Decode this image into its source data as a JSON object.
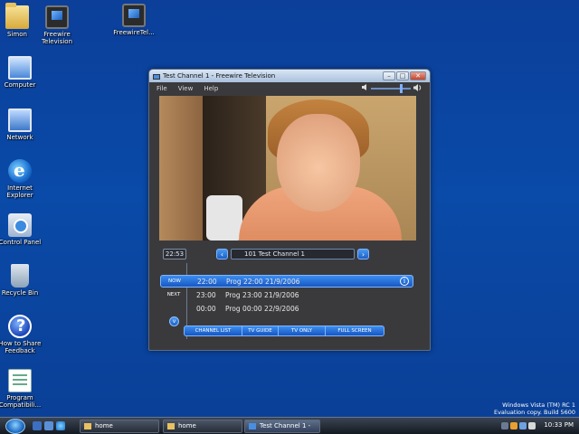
{
  "desktop": {
    "icons": [
      {
        "label": "Simon"
      },
      {
        "label": "Freewire Television"
      },
      {
        "label": "FreewireTel..."
      },
      {
        "label": "Computer"
      },
      {
        "label": "Network"
      },
      {
        "label": "Internet Explorer"
      },
      {
        "label": "Control Panel"
      },
      {
        "label": "Recycle Bin"
      },
      {
        "label": "How to Share Feedback"
      },
      {
        "label": "Program Compatibili..."
      }
    ]
  },
  "window": {
    "title": "Test Channel 1 - Freewire Television",
    "controls": {
      "minimize": "–",
      "maximize": "□",
      "close": "✕"
    },
    "menu": [
      "File",
      "View",
      "Help"
    ],
    "volume": {
      "level": 0.75,
      "low_icon": "speaker-low-icon",
      "high_icon": "speaker-high-icon"
    },
    "clock_display": "22:53",
    "channel": {
      "prev": "‹",
      "next": "›",
      "display": "101  Test Channel 1"
    },
    "schedule": [
      {
        "tag": "NOW",
        "time": "22:00",
        "program": "Prog 22:00 21/9/2006",
        "active": true
      },
      {
        "tag": "NEXT",
        "time": "23:00",
        "program": "Prog 23:00 21/9/2006",
        "active": false
      },
      {
        "tag": "",
        "time": "00:00",
        "program": "Prog 00:00 22/9/2006",
        "active": false
      }
    ],
    "info_glyph": "i",
    "expand_glyph": "v",
    "bottom_buttons": [
      "CHANNEL LIST",
      "TV GUIDE",
      "TV ONLY",
      "FULL SCREEN"
    ]
  },
  "watermark": {
    "line1": "Windows Vista (TM) RC 1",
    "line2": "Evaluation copy. Build 5600"
  },
  "taskbar": {
    "buttons": [
      {
        "label": "home"
      },
      {
        "label": "home"
      },
      {
        "label": "Test Channel 1 - Fre..."
      }
    ],
    "clock": "10:33 PM"
  },
  "colors": {
    "desktop": "#0a4aa8",
    "accent_blue": "#1c5fc6",
    "window_body": "#3a3a3d"
  }
}
